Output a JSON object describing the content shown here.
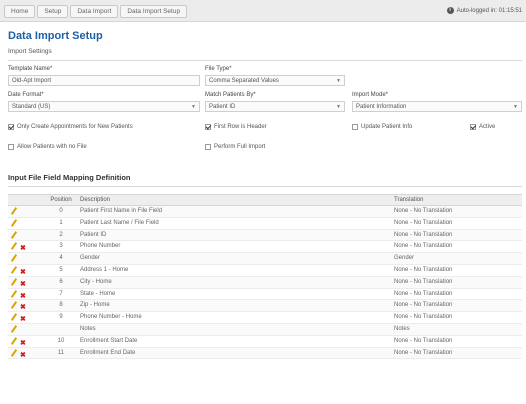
{
  "breadcrumb": {
    "items": [
      "Home",
      "Setup",
      "Data Import",
      "Data Import Setup"
    ],
    "logged_in": "Auto-logged in: 01:15:51"
  },
  "page": {
    "title": "Data Import Setup",
    "section": "Import Settings"
  },
  "form": {
    "template_name": {
      "label": "Template Name*",
      "value": "Old-Apt Import"
    },
    "file_type": {
      "label": "File Type*",
      "value": "Comma Separated Values"
    },
    "date_format": {
      "label": "Date Format*",
      "value": "Standard (US)"
    },
    "match_by": {
      "label": "Match Patients By*",
      "value": "Patient ID"
    },
    "import_mode": {
      "label": "Import Mode*",
      "value": "Patient Information"
    },
    "checks": {
      "only_create": "Only Create Appointments for New Patients",
      "first_row_header": "First Row is Header",
      "update_patient": "Update Patient Info",
      "active": "Active",
      "allow_duplicates": "Allow Patients with no File",
      "perform_full_import": "Perform Full Import"
    }
  },
  "mapping": {
    "title": "Input File Field Mapping Definition",
    "headers": {
      "position": "Position",
      "description": "Description",
      "translation": "Translation"
    },
    "rows": [
      {
        "position": "0",
        "description": "Patient First Name in File Field",
        "translation": "None - No Translation"
      },
      {
        "position": "1",
        "description": "Patient Last Name / File Field",
        "translation": "None - No Translation"
      },
      {
        "position": "2",
        "description": "Patient ID",
        "translation": "None - No Translation"
      },
      {
        "position": "3",
        "description": "Phone Number",
        "translation": "None - No Translation"
      },
      {
        "position": "4",
        "description": "Gender",
        "translation": "Gender"
      },
      {
        "position": "5",
        "description": "Address 1 - Home",
        "translation": "None - No Translation"
      },
      {
        "position": "6",
        "description": "City - Home",
        "translation": "None - No Translation"
      },
      {
        "position": "7",
        "description": "State - Home",
        "translation": "None - No Translation"
      },
      {
        "position": "8",
        "description": "Zip - Home",
        "translation": "None - No Translation"
      },
      {
        "position": "9",
        "description": "Phone Number - Home",
        "translation": "None - No Translation"
      },
      {
        "position": "",
        "description": "Notes",
        "translation": "Notes"
      },
      {
        "position": "10",
        "description": "Enrollment Start Date",
        "translation": "None - No Translation"
      },
      {
        "position": "11",
        "description": "Enrollment End Date",
        "translation": "None - No Translation"
      }
    ]
  }
}
